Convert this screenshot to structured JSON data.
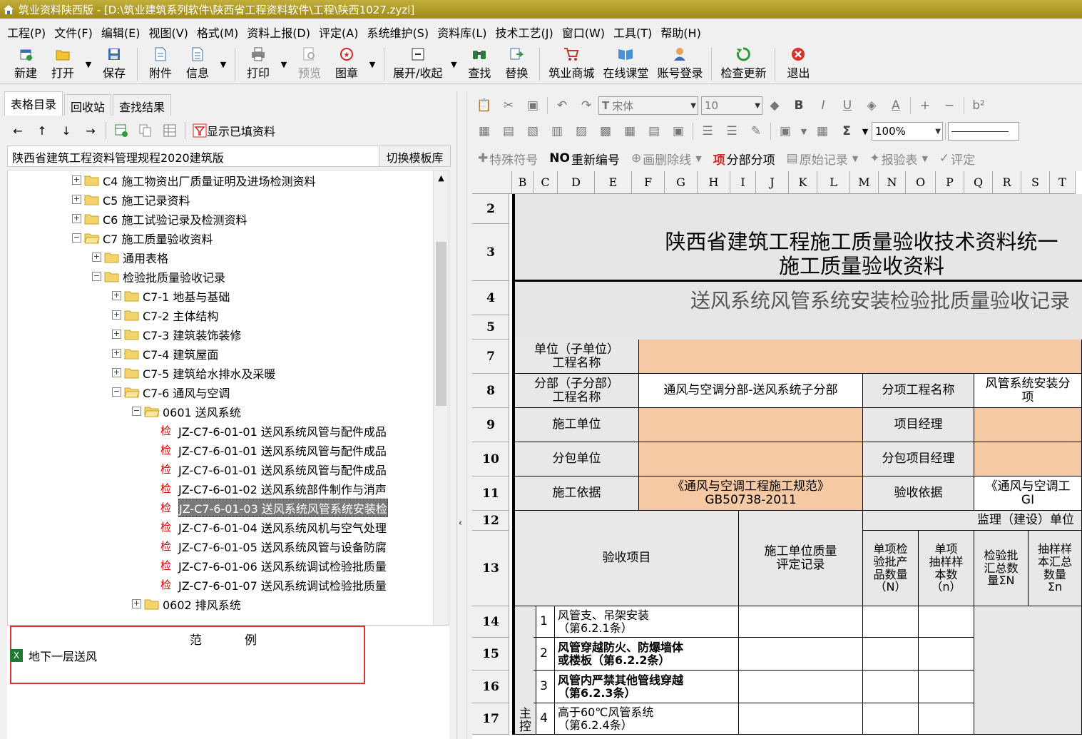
{
  "window": {
    "title": "筑业资料陕西版 - [D:\\筑业建筑系列软件\\陕西省工程资料软件\\工程\\陕西1027.zyzl]"
  },
  "menu": [
    "工程(P)",
    "文件(F)",
    "编辑(E)",
    "视图(V)",
    "格式(M)",
    "资料上报(D)",
    "评定(A)",
    "系统维护(S)",
    "资料库(L)",
    "技术工艺(J)",
    "窗口(W)",
    "工具(T)",
    "帮助(H)"
  ],
  "toolbar": {
    "new": "新建",
    "open": "打开",
    "save": "保存",
    "attach": "附件",
    "info": "信息",
    "print": "打印",
    "preview": "预览",
    "chart": "图章",
    "expand": "展开/收起",
    "find": "查找",
    "replace": "替换",
    "mall": "筑业商城",
    "course": "在线课堂",
    "login": "账号登录",
    "update": "检查更新",
    "exit": "退出"
  },
  "left": {
    "tabs": [
      "表格目录",
      "回收站",
      "查找结果"
    ],
    "show_filled": "显示已填资料",
    "template_name": "陕西省建筑工程资料管理规程2020建筑版",
    "switch_template": "切换模板库",
    "tree": [
      {
        "label": "C4 施工物资出厂质量证明及进场检测资料",
        "exp": "+",
        "folder": "closed"
      },
      {
        "label": "C5 施工记录资料",
        "exp": "+",
        "folder": "closed"
      },
      {
        "label": "C6 施工试验记录及检测资料",
        "exp": "+",
        "folder": "closed"
      },
      {
        "label": "C7 施工质量验收资料",
        "exp": "−",
        "folder": "open"
      },
      {
        "label": "通用表格",
        "exp": "+",
        "folder": "closed"
      },
      {
        "label": "检验批质量验收记录",
        "exp": "−",
        "folder": "closed"
      },
      {
        "label": "C7-1 地基与基础",
        "exp": "+",
        "folder": "closed"
      },
      {
        "label": "C7-2 主体结构",
        "exp": "+",
        "folder": "closed"
      },
      {
        "label": "C7-3 建筑装饰装修",
        "exp": "+",
        "folder": "closed"
      },
      {
        "label": "C7-4 建筑屋面",
        "exp": "+",
        "folder": "closed"
      },
      {
        "label": "C7-5 建筑给水排水及采暖",
        "exp": "+",
        "folder": "closed"
      },
      {
        "label": "C7-6 通风与空调",
        "exp": "−",
        "folder": "open"
      },
      {
        "label": "0601 送风系统",
        "exp": "−",
        "folder": "open"
      },
      {
        "label": "JZ-C7-6-01-01 送风系统风管与配件成品",
        "check": "检"
      },
      {
        "label": "JZ-C7-6-01-01 送风系统风管与配件成品",
        "check": "检"
      },
      {
        "label": "JZ-C7-6-01-01 送风系统风管与配件成品",
        "check": "检"
      },
      {
        "label": "JZ-C7-6-01-02 送风系统部件制作与消声",
        "check": "检"
      },
      {
        "label": "JZ-C7-6-01-03 送风系统风管系统安装检",
        "check": "检",
        "selected": true
      },
      {
        "label": "JZ-C7-6-01-04 送风系统风机与空气处理",
        "check": "检"
      },
      {
        "label": "JZ-C7-6-01-05 送风系统风管与设备防腐",
        "check": "检"
      },
      {
        "label": "JZ-C7-6-01-06 送风系统调试检验批质量",
        "check": "检"
      },
      {
        "label": "JZ-C7-6-01-07 送风系统调试检验批质量",
        "check": "检"
      },
      {
        "label": "0602 排风系统",
        "exp": "+",
        "folder": "closed"
      }
    ],
    "example_title": "范例",
    "example_item": "地下一层送风"
  },
  "editor": {
    "font": "宋体",
    "font_size": "10",
    "zoom": "100%",
    "special_symbol": "特殊符号",
    "renumber": "重新编号",
    "strike": "画删除线",
    "subitem": "分部分项",
    "original": "原始记录",
    "report": "报验表",
    "evaluate": "评定"
  },
  "sheet": {
    "columns": [
      "B",
      "C",
      "D",
      "E",
      "F",
      "G",
      "H",
      "I",
      "J",
      "K",
      "L",
      "M",
      "N",
      "O",
      "P",
      "Q",
      "R",
      "S",
      "T"
    ],
    "rows": [
      "2",
      "3",
      "4",
      "5",
      "7",
      "8",
      "9",
      "10",
      "11",
      "12",
      "13",
      "14",
      "15",
      "16",
      "17"
    ],
    "title1": "陕西省建筑工程施工质量验收技术资料统一\n施工质量验收资料",
    "title2": "送风系统风管系统安装检验批质量验收记录",
    "unit_name_label": "单位（子单位）\n工程名称",
    "division_label": "分部（子分部）\n工程名称",
    "division_value": "通风与空调分部-送风系统子分部",
    "subitem_label": "分项工程名称",
    "subitem_value": "风管系统安装分\n项",
    "contractor_label": "施工单位",
    "pm_label": "项目经理",
    "sub_label": "分包单位",
    "sub_pm_label": "分包项目经理",
    "basis_label": "施工依据",
    "basis_value": "《通风与空调工程施工规范》\nGB50738-2011",
    "accept_basis_label": "验收依据",
    "accept_basis_value": "《通风与空调工\nGI",
    "supervision_label": "监理（建设）单位",
    "item_label": "验收项目",
    "self_eval_label": "施工单位质量\n评定记录",
    "h_single_qty": "单项检\n验批产\n品数量\n（N）",
    "h_single_sample": "单项\n抽样样\n本数\n（n）",
    "h_total_qty": "检验批\n汇总数\n量ΣN",
    "h_total_sample": "抽样样\n本汇总\n数量\nΣn",
    "main_control": "主控",
    "items": [
      {
        "no": "1",
        "text": "风管支、吊架安装\n（第6.2.1条）",
        "bold": false
      },
      {
        "no": "2",
        "text": "风管穿越防火、防爆墙体\n或楼板（第6.2.2条）",
        "bold": true
      },
      {
        "no": "3",
        "text": "风管内严禁其他管线穿越\n（第6.2.3条）",
        "bold": true
      },
      {
        "no": "4",
        "text": "高于60℃风管系统\n（第6.2.4条）",
        "bold": false
      }
    ]
  },
  "colors": {
    "titlebar": "#b39d2a",
    "peach": "#f6c9a5",
    "selected": "#7a7a7a",
    "check_red": "#dd0000"
  }
}
